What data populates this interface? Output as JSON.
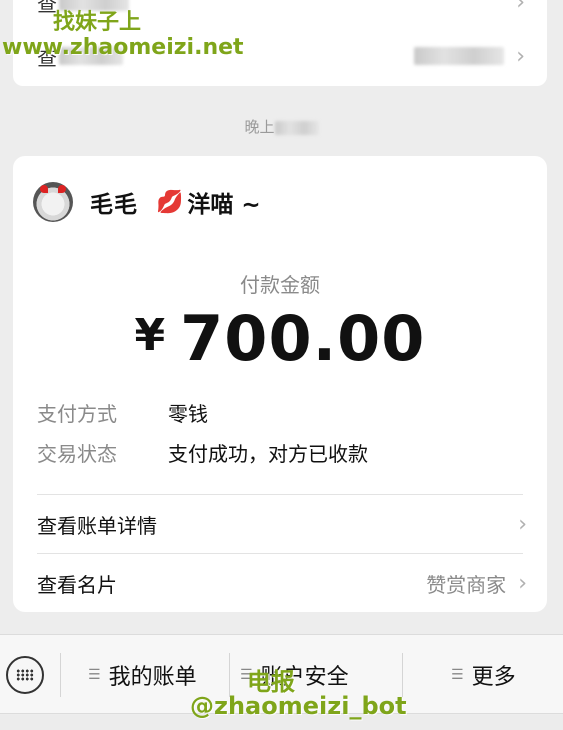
{
  "top_card": {
    "row1_label": "查",
    "row2_label": "查"
  },
  "time_label": "晚上",
  "payment": {
    "sender_name": "毛毛",
    "sender_emoji": "💋",
    "sender_nickname": "洋喵 ~",
    "amount_label": "付款金额",
    "currency": "¥",
    "amount": "700.00",
    "method_label": "支付方式",
    "method_value": "零钱",
    "status_label": "交易状态",
    "status_value": "支付成功，对方已收款",
    "bill_details_label": "查看账单详情",
    "card_label": "查看名片",
    "card_value": "赞赏商家"
  },
  "bottom_menu": {
    "items": [
      {
        "label": "我的账单"
      },
      {
        "label": "账户安全"
      },
      {
        "label": "更多"
      }
    ]
  },
  "watermark": {
    "line1": "找妹子上",
    "line2": "www.zhaomeizi.net",
    "line3": "电报",
    "line4": "@zhaomeizi_bot"
  },
  "icons": {
    "chevron": "chevron-right-icon",
    "keyboard": "keyboard-icon",
    "menu": "menu-icon"
  },
  "colors": {
    "background": "#ededed",
    "card": "#ffffff",
    "secondary_text": "#8a8a8a",
    "watermark": "#7fa51a"
  }
}
